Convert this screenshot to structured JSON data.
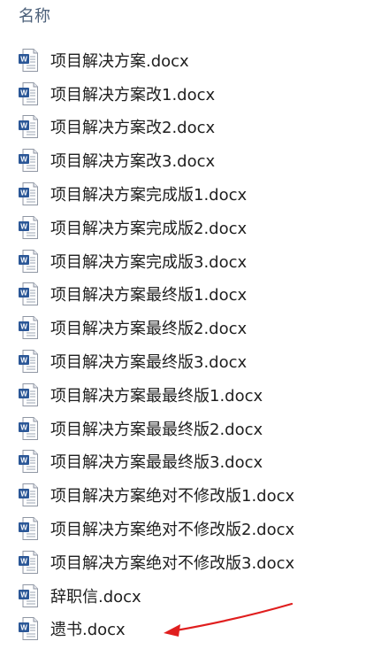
{
  "header": {
    "name_label": "名称"
  },
  "files": [
    {
      "name": "项目解决方案.docx",
      "icon": "word-document-icon"
    },
    {
      "name": "项目解决方案改1.docx",
      "icon": "word-document-icon"
    },
    {
      "name": "项目解决方案改2.docx",
      "icon": "word-document-icon"
    },
    {
      "name": "项目解决方案改3.docx",
      "icon": "word-document-icon"
    },
    {
      "name": "项目解决方案完成版1.docx",
      "icon": "word-document-icon"
    },
    {
      "name": "项目解决方案完成版2.docx",
      "icon": "word-document-icon"
    },
    {
      "name": "项目解决方案完成版3.docx",
      "icon": "word-document-icon"
    },
    {
      "name": "项目解决方案最终版1.docx",
      "icon": "word-document-icon"
    },
    {
      "name": "项目解决方案最终版2.docx",
      "icon": "word-document-icon"
    },
    {
      "name": "项目解决方案最终版3.docx",
      "icon": "word-document-icon"
    },
    {
      "name": "项目解决方案最最终版1.docx",
      "icon": "word-document-icon"
    },
    {
      "name": "项目解决方案最最终版2.docx",
      "icon": "word-document-icon"
    },
    {
      "name": "项目解决方案最最终版3.docx",
      "icon": "word-document-icon"
    },
    {
      "name": "项目解决方案绝对不修改版1.docx",
      "icon": "word-document-icon"
    },
    {
      "name": "项目解决方案绝对不修改版2.docx",
      "icon": "word-document-icon"
    },
    {
      "name": "项目解决方案绝对不修改版3.docx",
      "icon": "word-document-icon"
    },
    {
      "name": "辞职信.docx",
      "icon": "word-document-icon"
    },
    {
      "name": "遗书.docx",
      "icon": "word-document-icon"
    }
  ],
  "annotation": {
    "arrow_color": "#e01e1e",
    "points_to": "遗书.docx"
  },
  "colors": {
    "header_text": "#4c607a",
    "icon_blue": "#2b5797",
    "file_text": "#1e1e1e"
  }
}
